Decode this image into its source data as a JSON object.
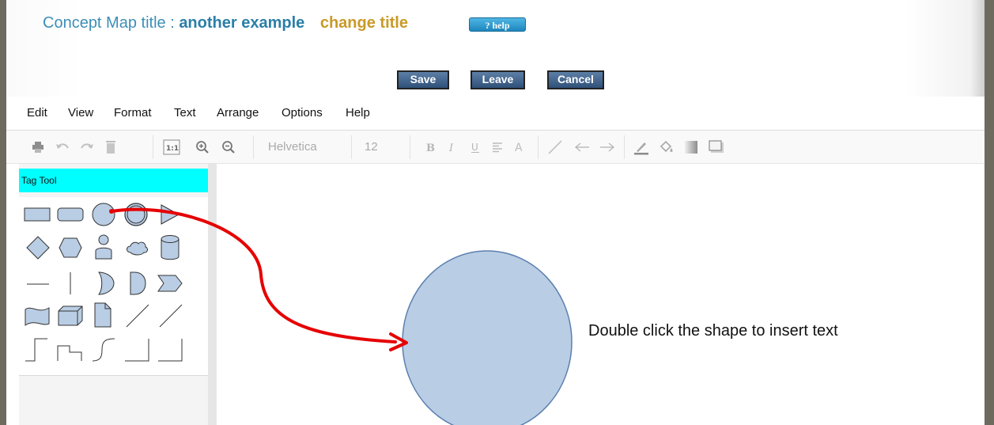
{
  "header": {
    "title_prefix": "Concept Map title :",
    "title_name": "another example",
    "change_title_link": "change title",
    "help_button": "? help"
  },
  "actions": {
    "save": "Save",
    "leave": "Leave",
    "cancel": "Cancel"
  },
  "menu": [
    "Edit",
    "View",
    "Format",
    "Text",
    "Arrange",
    "Options",
    "Help"
  ],
  "toolbar": {
    "font_family": "Helvetica",
    "font_size": "12",
    "icons": [
      "print-icon",
      "undo-icon",
      "redo-icon",
      "delete-icon",
      "actual-size-icon",
      "zoom-in-icon",
      "zoom-out-icon",
      "bold-icon",
      "italic-icon",
      "underline-icon",
      "align-icon",
      "font-color-icon",
      "line-icon",
      "arrow-left-icon",
      "arrow-right-icon",
      "line-color-icon",
      "fill-color-icon",
      "gradient-icon",
      "shadow-icon"
    ]
  },
  "sidebar": {
    "panel_title": "Tag Tool"
  },
  "canvas": {
    "hint": "Double click the shape to insert text"
  },
  "colors": {
    "shape_fill": "#b9cde4",
    "shape_stroke": "#5b80b0",
    "annotation_arrow": "#e60000",
    "tag_tool_bg": "#00ffff"
  }
}
